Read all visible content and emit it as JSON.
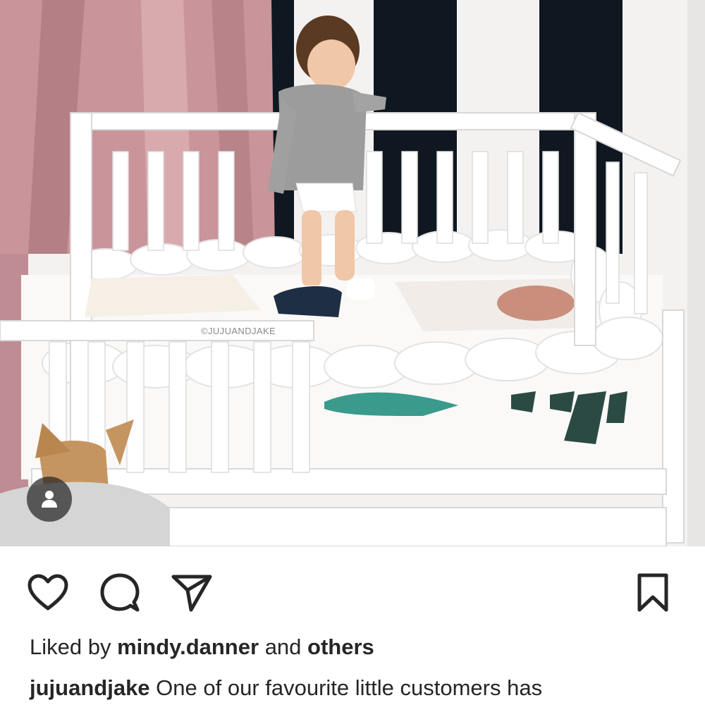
{
  "post": {
    "image": {
      "description_icon": "photo",
      "watermark": "©JUJUANDJAKE"
    },
    "tag_button": {
      "icon": "user-tag-icon"
    },
    "actions": {
      "like_icon": "heart-outline-icon",
      "comment_icon": "comment-bubble-icon",
      "share_icon": "paper-plane-icon",
      "save_icon": "bookmark-outline-icon"
    },
    "likes": {
      "prefix": "Liked by",
      "user": "mindy.danner",
      "connector": "and",
      "others": "others"
    },
    "caption": {
      "username": "jujuandjake",
      "text": "One of our favourite little customers has"
    }
  },
  "colors": {
    "text": "#262626",
    "background": "#ffffff",
    "tag_overlay": "#262626"
  }
}
